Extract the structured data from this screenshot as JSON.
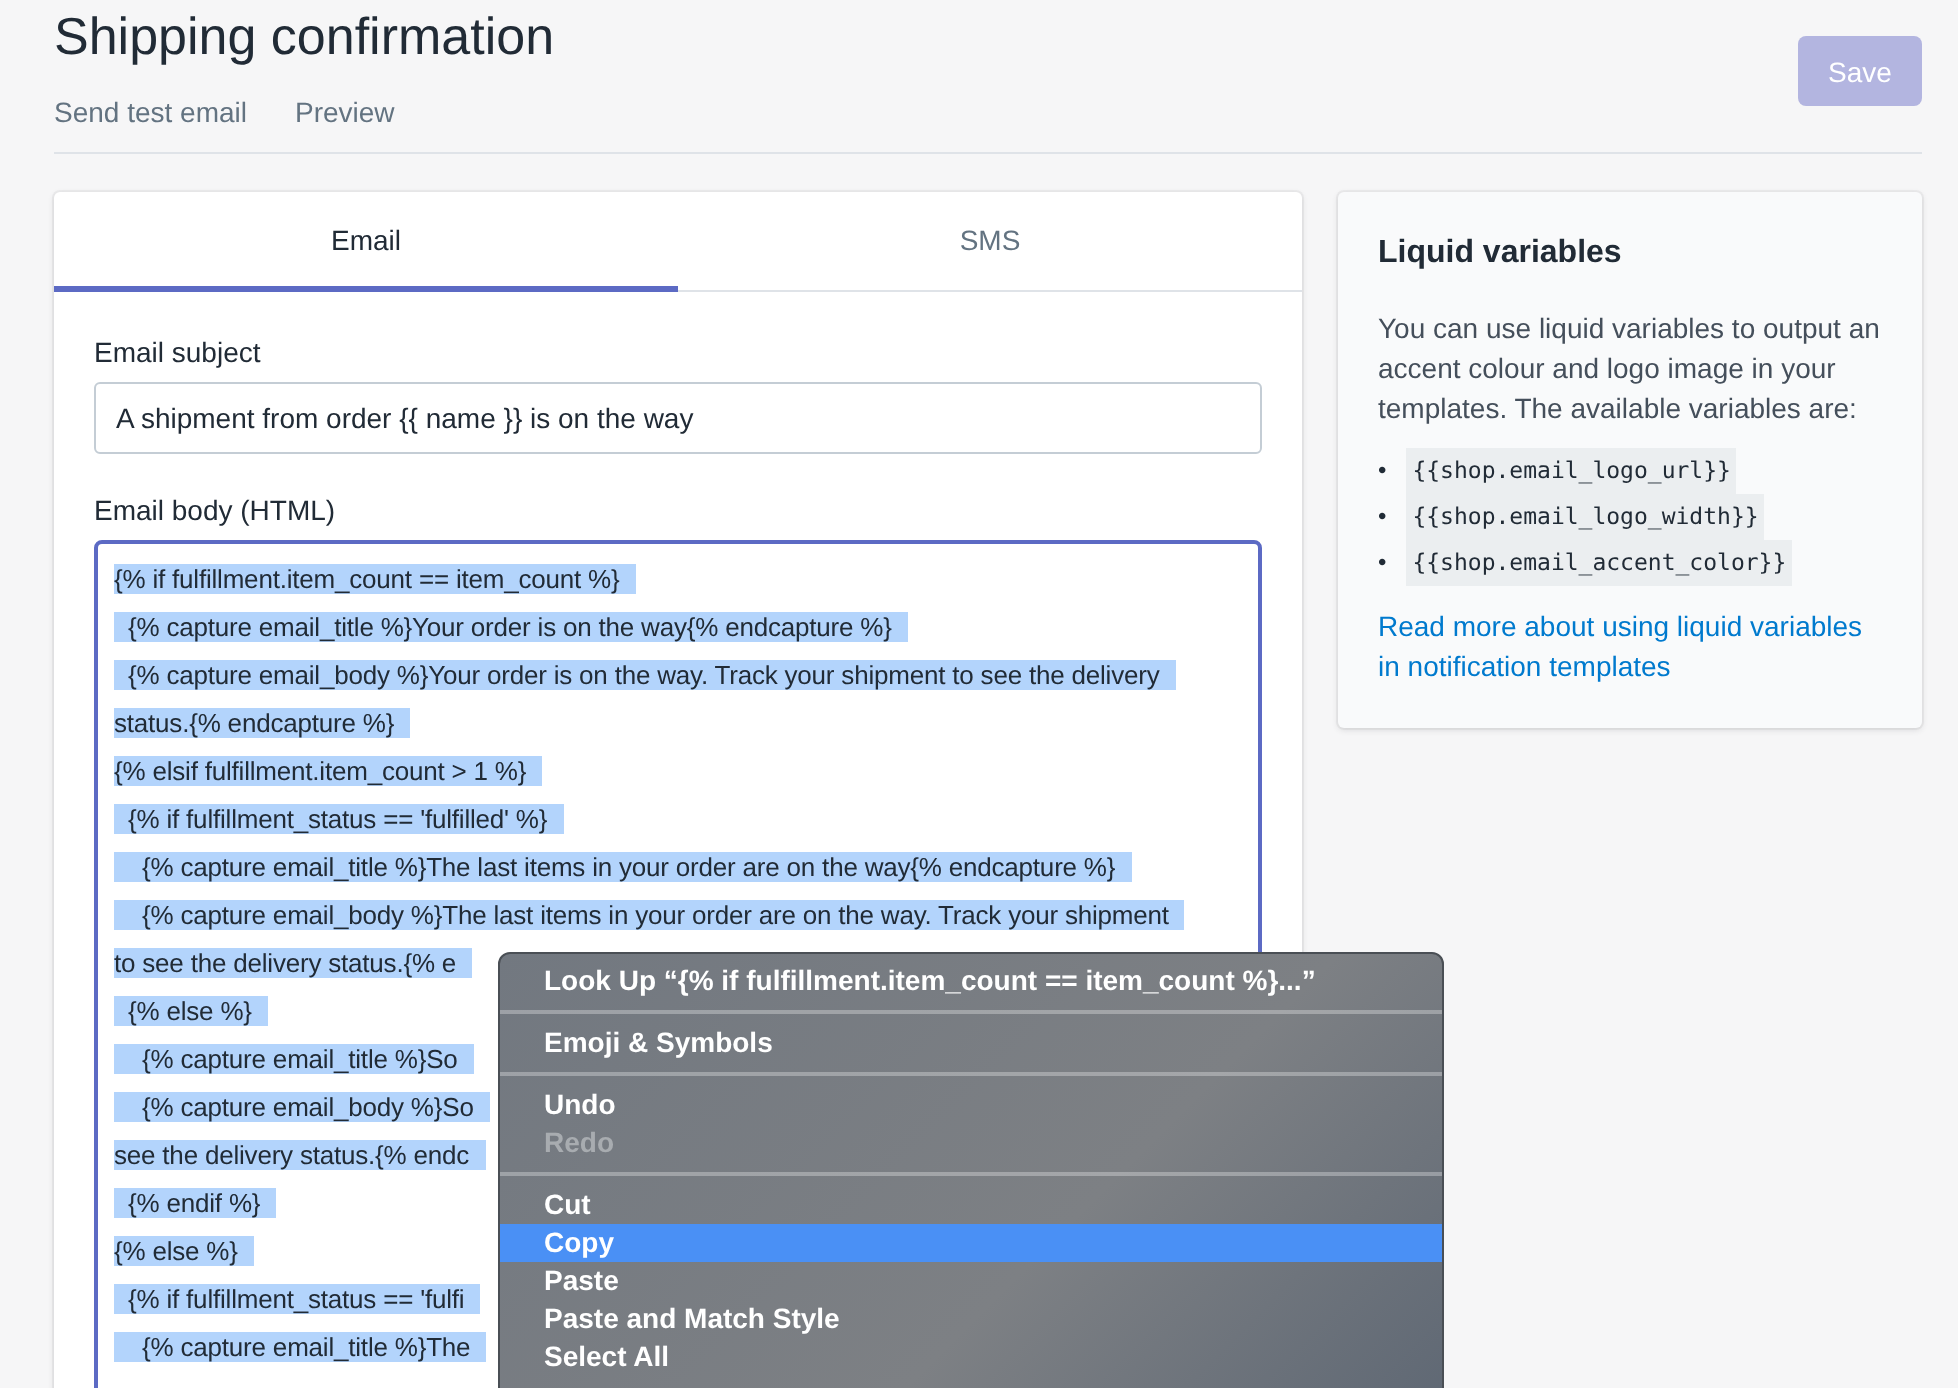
{
  "header": {
    "title": "Shipping confirmation",
    "links": [
      "Send test email",
      "Preview"
    ],
    "save_button": {
      "label": "Save",
      "disabled": true
    }
  },
  "tabs": [
    {
      "label": "Email",
      "selected": true
    },
    {
      "label": "SMS",
      "selected": false
    }
  ],
  "subject": {
    "label": "Email subject",
    "value": "A shipment from order {{ name }} is on the way"
  },
  "body": {
    "label": "Email body (HTML)",
    "lines": [
      {
        "text": "{% if fulfillment.item_count == item_count %}",
        "selected": true
      },
      {
        "text": "  {% capture email_title %}Your order is on the way{% endcapture %}",
        "selected": true
      },
      {
        "text": "  {% capture email_body %}Your order is on the way. Track your shipment to see the delivery",
        "selected": true
      },
      {
        "text": "status.{% endcapture %}",
        "selected": true
      },
      {
        "text": "{% elsif fulfillment.item_count > 1 %}",
        "selected": true
      },
      {
        "text": "  {% if fulfillment_status == 'fulfilled' %}",
        "selected": true
      },
      {
        "text": "    {% capture email_title %}The last items in your order are on the way{% endcapture %}",
        "selected": true
      },
      {
        "text": "    {% capture email_body %}The last items in your order are on the way. Track your shipment",
        "selected": true
      },
      {
        "text": "to see the delivery status.{% e",
        "selected": true
      },
      {
        "text": "  {% else %}",
        "selected": true
      },
      {
        "text": "    {% capture email_title %}So",
        "selected": true
      },
      {
        "text": "    {% capture email_body %}So",
        "selected": true
      },
      {
        "text": "see the delivery status.{% endc",
        "selected": true
      },
      {
        "text": "  {% endif %}",
        "selected": true
      },
      {
        "text": "{% else %}",
        "selected": true
      },
      {
        "text": "  {% if fulfillment_status == 'fulfi",
        "selected": true
      },
      {
        "text": "    {% capture email_title %}The",
        "selected": true
      }
    ]
  },
  "sidebar": {
    "title": "Liquid variables",
    "text": "You can use liquid variables to output an accent colour and logo image in your templates. The available variables are:",
    "variables": [
      {
        "bullet": "•",
        "code": "{{shop.email_logo_url}}"
      },
      {
        "bullet": "•",
        "code": "{{shop.email_logo_width}}"
      },
      {
        "bullet": "•",
        "code": "{{shop.email_accent_color}}"
      }
    ],
    "link": "Read more about using liquid variables in notification templates"
  },
  "context_menu": [
    {
      "kind": "item",
      "label": "Look Up “{% if fulfillment.item_count == item_count %}...”",
      "disabled": false,
      "selected": false
    },
    {
      "kind": "separator"
    },
    {
      "kind": "item",
      "label": "Emoji & Symbols",
      "disabled": false,
      "selected": false
    },
    {
      "kind": "separator"
    },
    {
      "kind": "item",
      "label": "Undo",
      "disabled": false,
      "selected": false
    },
    {
      "kind": "item",
      "label": "Redo",
      "disabled": true,
      "selected": false
    },
    {
      "kind": "separator"
    },
    {
      "kind": "item",
      "label": "Cut",
      "disabled": false,
      "selected": false
    },
    {
      "kind": "item",
      "label": "Copy",
      "disabled": false,
      "selected": true
    },
    {
      "kind": "item",
      "label": "Paste",
      "disabled": false,
      "selected": false
    },
    {
      "kind": "item",
      "label": "Paste and Match Style",
      "disabled": false,
      "selected": false
    },
    {
      "kind": "item",
      "label": "Select All",
      "disabled": false,
      "selected": false
    }
  ]
}
